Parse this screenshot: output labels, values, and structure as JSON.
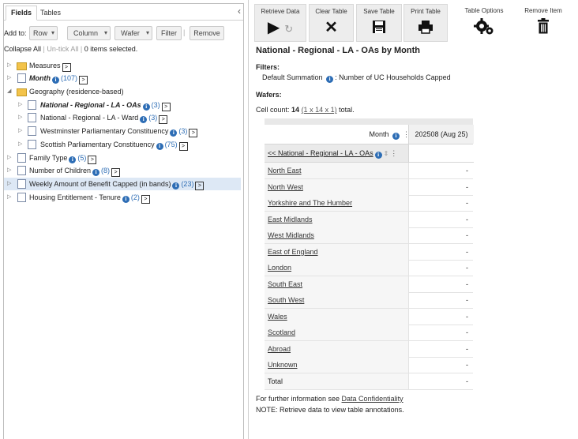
{
  "left_panel": {
    "tabs": [
      "Fields",
      "Tables"
    ],
    "add_to_label": "Add to:",
    "add_buttons": {
      "row": "Row",
      "column": "Column",
      "wafer": "Wafer",
      "filter": "Filter",
      "remove": "Remove"
    },
    "collapse_all": "Collapse All",
    "untick_all": "Un-tick All",
    "items_selected": "0 items selected.",
    "tree": [
      {
        "label": "Measures",
        "count": ""
      },
      {
        "label": "Month",
        "count": "(107)"
      },
      {
        "label": "Geography (residence-based)",
        "count": ""
      },
      {
        "label": "National - Regional - LA - OAs",
        "count": "(3)"
      },
      {
        "label": "National - Regional - LA - Ward",
        "count": "(3)"
      },
      {
        "label": "Westminster Parliamentary Constituency",
        "count": "(3)"
      },
      {
        "label": "Scottish Parliamentary Constituency",
        "count": "(75)"
      },
      {
        "label": "Family Type",
        "count": "(5)"
      },
      {
        "label": "Number of Children",
        "count": "(8)"
      },
      {
        "label": "Weekly Amount of Benefit Capped (in bands)",
        "count": "(23)"
      },
      {
        "label": "Housing Entitlement - Tenure",
        "count": "(2)"
      }
    ]
  },
  "toolbar": {
    "retrieve": "Retrieve Data",
    "clear": "Clear Table",
    "save": "Save Table",
    "print": "Print Table",
    "options": "Table Options",
    "remove_item": "Remove Item"
  },
  "main": {
    "title": "National - Regional - LA - OAs by Month",
    "filters_label": "Filters:",
    "filter_name": "Default Summation",
    "filter_value": ": Number of UC Households Capped",
    "wafers_label": "Wafers:",
    "cell_count_prefix": "Cell count: ",
    "cell_count": "14",
    "cell_dims": "(1 x 14 x 1)",
    "cell_suffix": " total.",
    "month_label": "Month",
    "column_header": "202508 (Aug 25)",
    "row_dim_label": "<< National - Regional - LA - OAs",
    "rows": [
      {
        "label": "North East",
        "value": "-"
      },
      {
        "label": "North West",
        "value": "-"
      },
      {
        "label": "Yorkshire and The Humber",
        "value": "-"
      },
      {
        "label": "East Midlands",
        "value": "-"
      },
      {
        "label": "West Midlands",
        "value": "-"
      },
      {
        "label": "East of England",
        "value": "-"
      },
      {
        "label": "London",
        "value": "-"
      },
      {
        "label": "South East",
        "value": "-"
      },
      {
        "label": "South West",
        "value": "-"
      },
      {
        "label": "Wales",
        "value": "-"
      },
      {
        "label": "Scotland",
        "value": "-"
      },
      {
        "label": "Abroad",
        "value": "-"
      },
      {
        "label": "Unknown",
        "value": "-"
      },
      {
        "label": "Total",
        "value": "-"
      }
    ],
    "footer_prefix": "For further information see ",
    "footer_link": "Data Confidentiality",
    "footer_note": "NOTE: Retrieve data to view table annotations."
  }
}
